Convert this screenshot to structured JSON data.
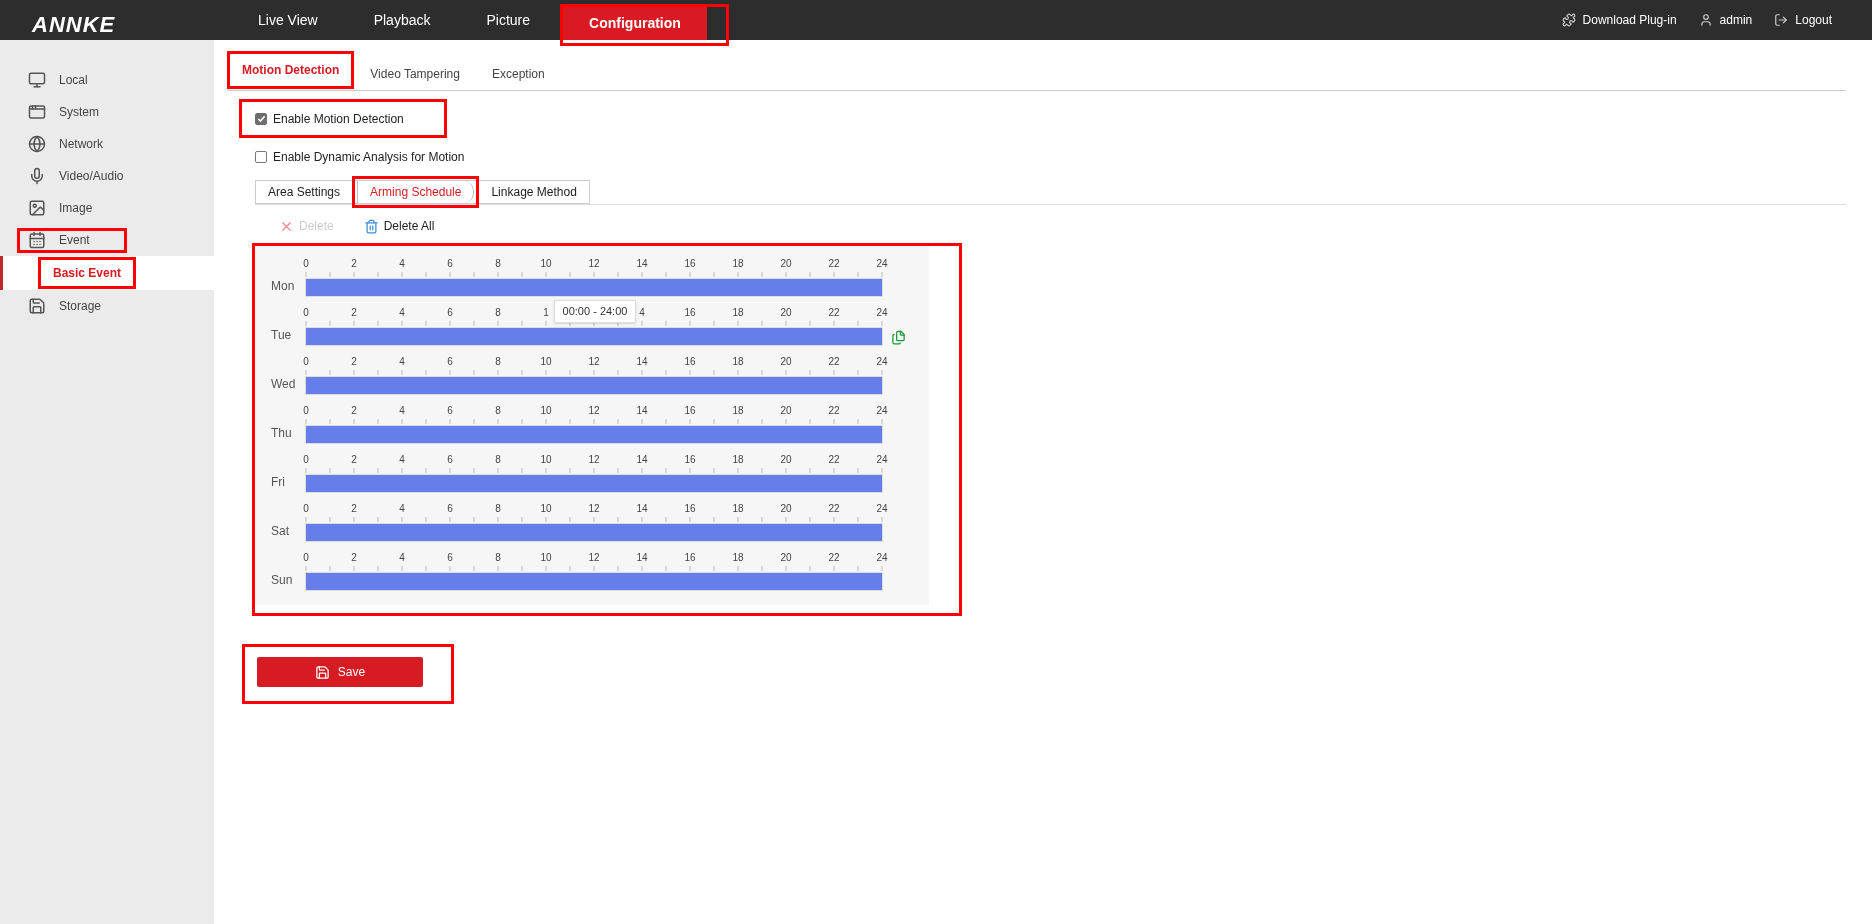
{
  "header": {
    "logo": "ANNKE",
    "nav": [
      {
        "label": "Live View",
        "selected": false
      },
      {
        "label": "Playback",
        "selected": false
      },
      {
        "label": "Picture",
        "selected": false
      },
      {
        "label": "Configuration",
        "selected": true
      }
    ],
    "links": [
      {
        "kind": "plugin",
        "label": "Download Plug-in"
      },
      {
        "kind": "user",
        "label": "admin"
      },
      {
        "kind": "logout",
        "label": "Logout"
      }
    ]
  },
  "sidebar": {
    "items": [
      {
        "kind": "local",
        "label": "Local",
        "selected": false
      },
      {
        "kind": "system",
        "label": "System",
        "selected": false
      },
      {
        "kind": "network",
        "label": "Network",
        "selected": false
      },
      {
        "kind": "video",
        "label": "Video/Audio",
        "selected": false
      },
      {
        "kind": "image",
        "label": "Image",
        "selected": false
      },
      {
        "kind": "event",
        "label": "Event",
        "selected": false,
        "expanded": true,
        "children": [
          {
            "label": "Basic Event",
            "selected": true
          }
        ]
      },
      {
        "kind": "storage",
        "label": "Storage",
        "selected": false
      }
    ]
  },
  "tabs": [
    {
      "label": "Motion Detection",
      "selected": true
    },
    {
      "label": "Video Tampering",
      "selected": false
    },
    {
      "label": "Exception",
      "selected": false
    }
  ],
  "options": [
    {
      "label": "Enable Motion Detection",
      "checked": true
    },
    {
      "label": "Enable Dynamic Analysis for Motion",
      "checked": false
    }
  ],
  "subtabs": [
    {
      "label": "Area Settings",
      "selected": false
    },
    {
      "label": "Arming Schedule",
      "selected": true
    },
    {
      "label": "Linkage Method",
      "selected": false
    }
  ],
  "toolbar": [
    {
      "kind": "delete",
      "label": "Delete",
      "disabled": true
    },
    {
      "kind": "delete_all",
      "label": "Delete All",
      "disabled": false
    }
  ],
  "schedule": {
    "days": [
      {
        "label": "Mon",
        "ticks": [
          "0",
          "2",
          "4",
          "6",
          "8",
          "10",
          "12",
          "14",
          "16",
          "18",
          "20",
          "22",
          "24"
        ]
      },
      {
        "label": "Tue",
        "copy": true,
        "tooltip": "00:00 - 24:00",
        "ticks": [
          "0",
          "2",
          "4",
          "6",
          "8",
          "1",
          "4",
          "16",
          "18",
          "20",
          "22",
          "24"
        ]
      },
      {
        "label": "Wed",
        "ticks": [
          "0",
          "2",
          "4",
          "6",
          "8",
          "10",
          "12",
          "14",
          "16",
          "18",
          "20",
          "22",
          "24"
        ]
      },
      {
        "label": "Thu",
        "ticks": [
          "0",
          "2",
          "4",
          "6",
          "8",
          "10",
          "12",
          "14",
          "16",
          "18",
          "20",
          "22",
          "24"
        ]
      },
      {
        "label": "Fri",
        "ticks": [
          "0",
          "2",
          "4",
          "6",
          "8",
          "10",
          "12",
          "14",
          "16",
          "18",
          "20",
          "22",
          "24"
        ]
      },
      {
        "label": "Sat",
        "ticks": [
          "0",
          "2",
          "4",
          "6",
          "8",
          "10",
          "12",
          "14",
          "16",
          "18",
          "20",
          "22",
          "24"
        ]
      },
      {
        "label": "Sun",
        "ticks": [
          "0",
          "2",
          "4",
          "6",
          "8",
          "10",
          "12",
          "14",
          "16",
          "18",
          "20",
          "22",
          "24"
        ]
      }
    ]
  },
  "save": {
    "label": "Save"
  }
}
